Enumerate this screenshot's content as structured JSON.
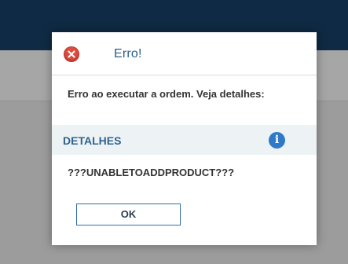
{
  "dialog": {
    "title": "Erro!",
    "icon": "error-icon",
    "message": "Erro ao executar a ordem. Veja detalhes:",
    "details_label": "DETALHES",
    "details_icon": "info-icon",
    "details_icon_glyph": "i",
    "detail_text": "???UNABLETOADDPRODUCT???",
    "ok_label": "OK"
  },
  "colors": {
    "topbar": "#0f2a44",
    "title": "#2a5f8a",
    "details_accent": "#2f6390",
    "info_icon": "#2e79c8",
    "error_icon": "#e14b3f"
  }
}
